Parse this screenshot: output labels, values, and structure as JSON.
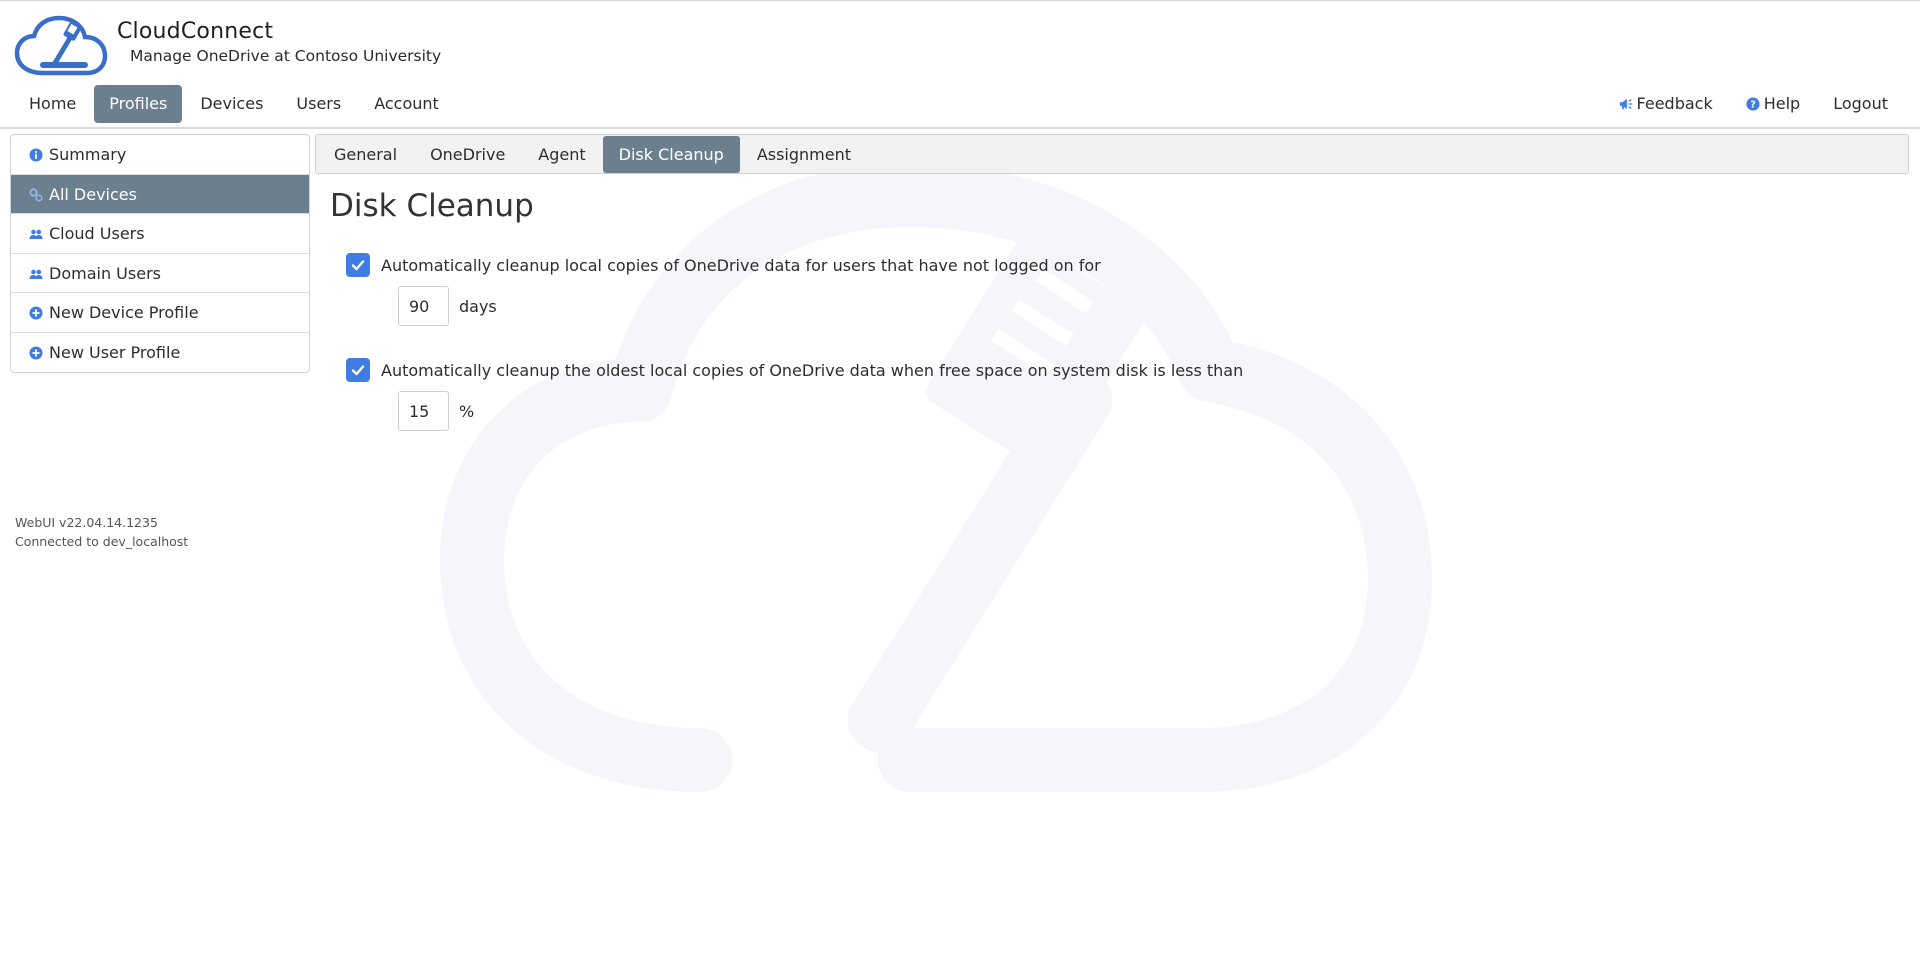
{
  "brand": {
    "title": "CloudConnect",
    "subtitle": "Manage OneDrive at Contoso University"
  },
  "nav": {
    "items": [
      {
        "label": "Home",
        "active": false
      },
      {
        "label": "Profiles",
        "active": true
      },
      {
        "label": "Devices",
        "active": false
      },
      {
        "label": "Users",
        "active": false
      },
      {
        "label": "Account",
        "active": false
      }
    ],
    "right": {
      "feedback": {
        "label": "Feedback",
        "icon": "megaphone-icon"
      },
      "help": {
        "label": "Help",
        "icon": "question-circle-icon"
      },
      "logout": {
        "label": "Logout"
      }
    }
  },
  "sidebar": {
    "items": [
      {
        "label": "Summary",
        "icon": "info-icon",
        "active": false
      },
      {
        "label": "All Devices",
        "icon": "devices-icon",
        "active": true
      },
      {
        "label": "Cloud Users",
        "icon": "users-icon",
        "active": false
      },
      {
        "label": "Domain Users",
        "icon": "users-icon",
        "active": false
      },
      {
        "label": "New Device Profile",
        "icon": "plus-circle-icon",
        "active": false
      },
      {
        "label": "New User Profile",
        "icon": "plus-circle-icon",
        "active": false
      }
    ]
  },
  "footer": {
    "version": "WebUI v22.04.14.1235",
    "connection": "Connected to dev_localhost"
  },
  "tabs": [
    {
      "label": "General",
      "active": false
    },
    {
      "label": "OneDrive",
      "active": false
    },
    {
      "label": "Agent",
      "active": false
    },
    {
      "label": "Disk Cleanup",
      "active": true
    },
    {
      "label": "Assignment",
      "active": false
    }
  ],
  "main": {
    "title": "Disk Cleanup",
    "options": [
      {
        "checked": true,
        "label": "Automatically cleanup local copies of OneDrive data for users that have not logged on for",
        "value": "90",
        "unit": "days"
      },
      {
        "checked": true,
        "label": "Automatically cleanup the oldest local copies of OneDrive data when free space on system disk is less than",
        "value": "15",
        "unit": "%"
      }
    ]
  },
  "colors": {
    "active_nav": "#6c7f8e",
    "checkbox": "#3f7de3",
    "icon_blue": "#3f7de3",
    "logo_blue": "#3a6fc9"
  }
}
